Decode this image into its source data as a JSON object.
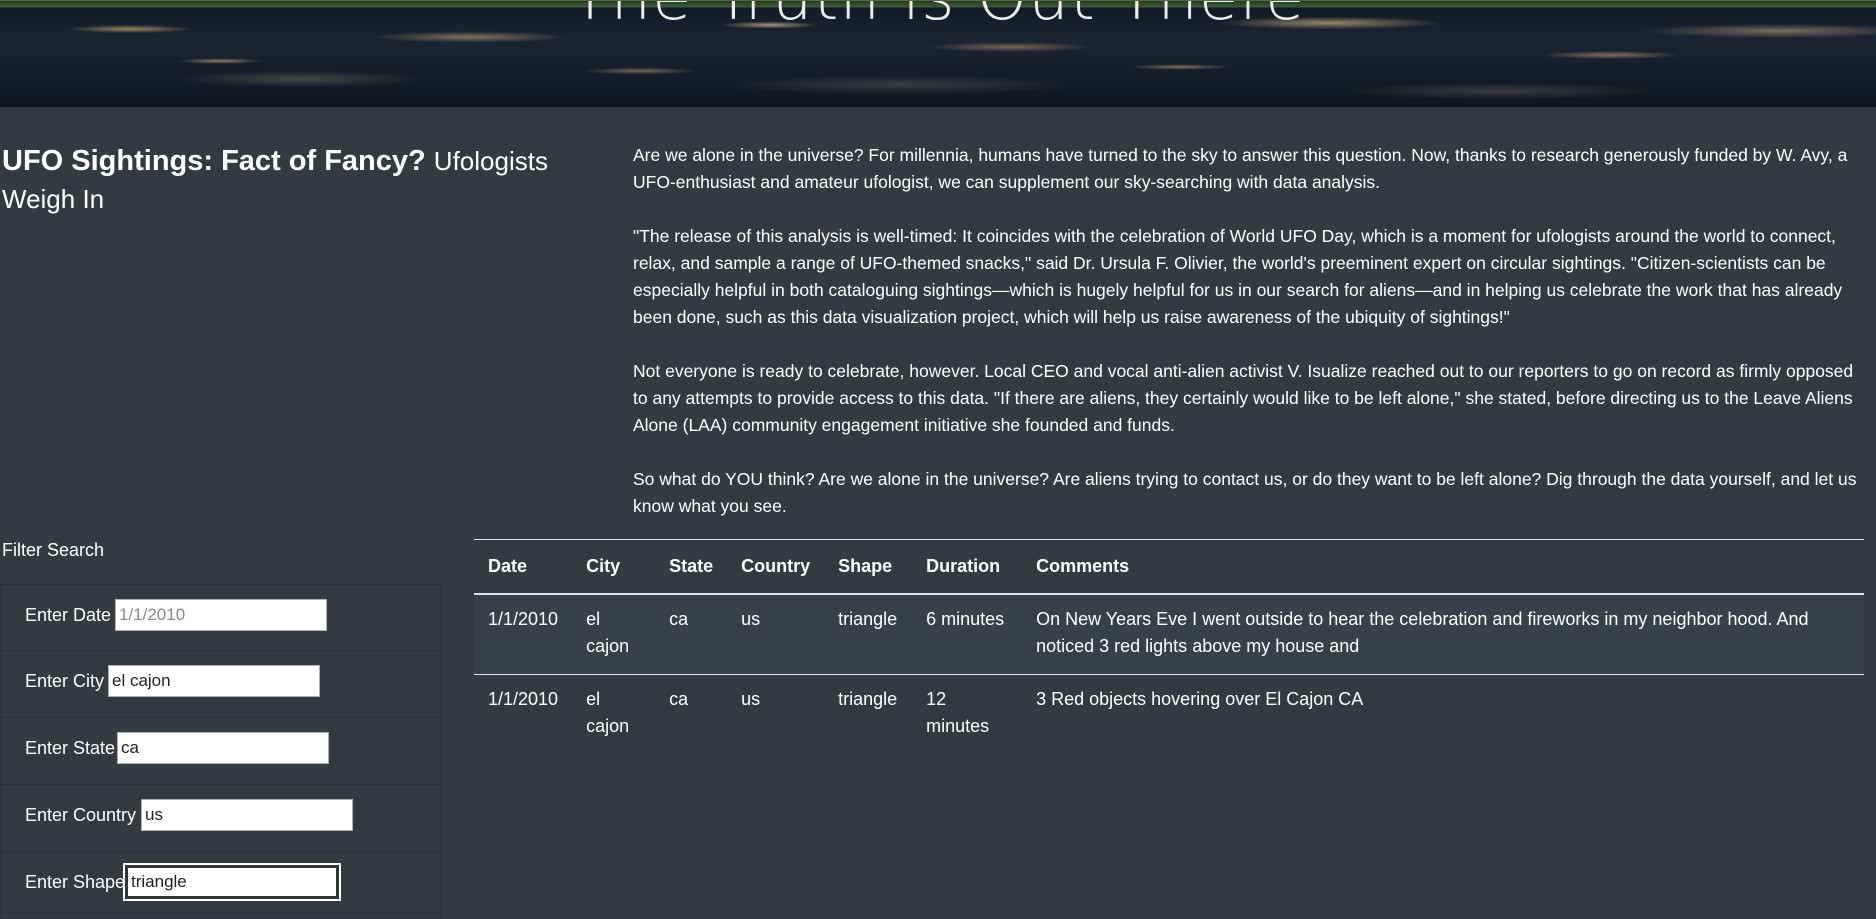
{
  "hero": {
    "title": "The Truth is Out There"
  },
  "intro": {
    "title": "UFO Sightings: Fact of Fancy?",
    "subtitle": "Ufologists Weigh In"
  },
  "article": {
    "paragraphs": [
      "Are we alone in the universe? For millennia, humans have turned to the sky to answer this question. Now, thanks to research generously funded by W. Avy, a UFO-enthusiast and amateur ufologist, we can supplement our sky-searching with data analysis.",
      "\"The release of this analysis is well-timed: It coincides with the celebration of World UFO Day, which is a moment for ufologists around the world to connect, relax, and sample a range of UFO-themed snacks,\" said Dr. Ursula F. Olivier, the world's preeminent expert on circular sightings. \"Citizen-scientists can be especially helpful in both cataloguing sightings—which is hugely helpful for us in our search for aliens—and in helping us celebrate the work that has already been done, such as this data visualization project, which will help us raise awareness of the ubiquity of sightings!\"",
      "Not everyone is ready to celebrate, however. Local CEO and vocal anti-alien activist V. Isualize reached out to our reporters to go on record as firmly opposed to any attempts to provide access to this data. \"If there are aliens, they certainly would like to be left alone,\" she stated, before directing us to the Leave Aliens Alone (LAA) community engagement initiative she founded and funds.",
      "So what do YOU think? Are we alone in the universe? Are aliens trying to contact us, or do they want to be left alone? Dig through the data yourself, and let us know what you see."
    ]
  },
  "filters": {
    "heading": "Filter Search",
    "date": {
      "label": "Enter Date",
      "placeholder": "1/1/2010",
      "value": ""
    },
    "city": {
      "label": "Enter City",
      "placeholder": "",
      "value": "el cajon"
    },
    "state": {
      "label": "Enter State",
      "placeholder": "",
      "value": "ca"
    },
    "country": {
      "label": "Enter Country",
      "placeholder": "",
      "value": "us"
    },
    "shape": {
      "label": "Enter Shape",
      "placeholder": "",
      "value": "triangle"
    }
  },
  "table": {
    "headers": [
      "Date",
      "City",
      "State",
      "Country",
      "Shape",
      "Duration",
      "Comments"
    ],
    "rows": [
      [
        "1/1/2010",
        "el cajon",
        "ca",
        "us",
        "triangle",
        "6 minutes",
        "On New Years Eve I went outside to hear the celebration and fireworks in my neighbor hood. And noticed 3 red lights above my house and"
      ],
      [
        "1/1/2010",
        "el cajon",
        "ca",
        "us",
        "triangle",
        "12 minutes",
        "3 Red objects hovering over El Cajon CA"
      ]
    ]
  }
}
